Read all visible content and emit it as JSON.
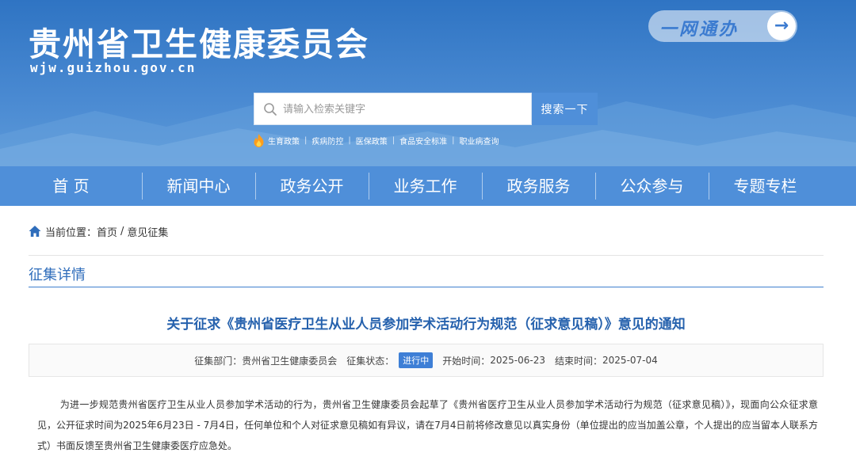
{
  "header": {
    "site_title": "贵州省卫生健康委员会",
    "site_domain": "wjw.guizhou.gov.cn",
    "one_net_label": "一网通办",
    "one_net_arrow": "→",
    "search": {
      "placeholder": "请输入检索关键字",
      "button_label": "搜索一下"
    },
    "hot_links": [
      "生育政策",
      "疾病防控",
      "医保政策",
      "食品安全标准",
      "职业病查询"
    ],
    "hot_sep": "|"
  },
  "nav": {
    "items": [
      "首 页",
      "新闻中心",
      "政务公开",
      "业务工作",
      "政务服务",
      "公众参与",
      "专题专栏"
    ]
  },
  "breadcrumb": {
    "prefix": "当前位置：",
    "home": "首页",
    "sep": "/",
    "current": "意见征集"
  },
  "section_title": "征集详情",
  "article": {
    "title": "关于征求《贵州省医疗卫生从业人员参加学术活动行为规范（征求意见稿）》意见的通知",
    "meta": {
      "dept_label": "征集部门：",
      "dept": "贵州省卫生健康委员会",
      "status_label": "征集状态：",
      "status": "进行中",
      "start_label": "开始时间：",
      "start": "2025-06-23",
      "end_label": "结束时间：",
      "end": "2025-07-04"
    },
    "body": "为进一步规范贵州省医疗卫生从业人员参加学术活动的行为，贵州省卫生健康委员会起草了《贵州省医疗卫生从业人员参加学术活动行为规范（征求意见稿）》，现面向公众征求意见，公开征求时间为2025年6月23日 - 7月4日，任何单位和个人对征求意见稿如有异议，请在7月4日前将修改意见以真实身份（单位提出的应当加盖公章，个人提出的应当留本人联系方式）书面反馈至贵州省卫生健康委医疗应急处。"
  },
  "colors": {
    "header_blue": "#2f74c3",
    "nav_blue": "#4f8fd9",
    "title_blue": "#2561ad",
    "status_badge": "#3e7fd6"
  },
  "icons": [
    "search-icon",
    "flame-icon",
    "home-icon",
    "arrow-right-icon"
  ]
}
